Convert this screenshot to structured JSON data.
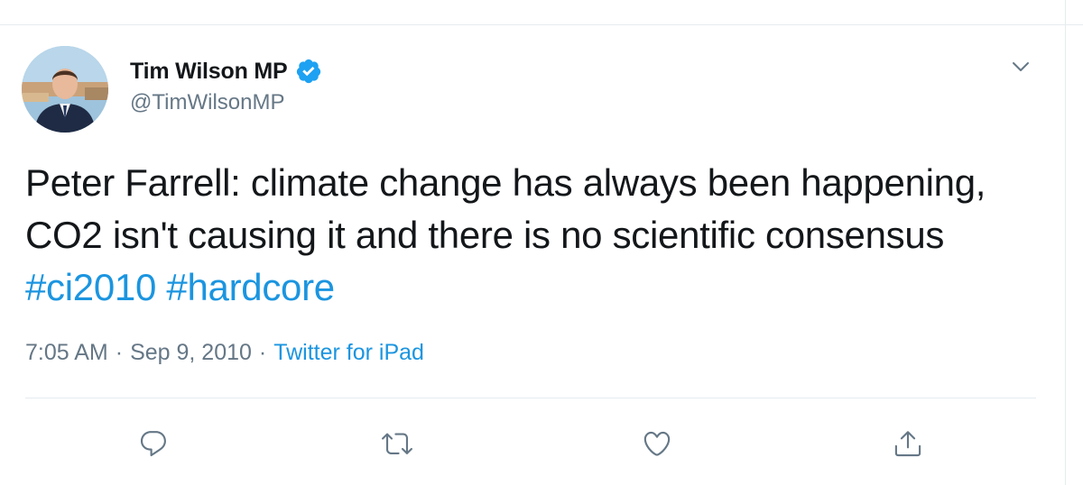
{
  "tweet": {
    "author": {
      "name": "Tim Wilson MP",
      "handle": "@TimWilsonMP",
      "verified": true
    },
    "text_plain": "Peter Farrell: climate change has always been happening, CO2 isn't causing it and there is no scientific consensus",
    "hashtags": [
      "#ci2010",
      "#hardcore"
    ],
    "meta": {
      "time": "7:05 AM",
      "separator": "·",
      "date": "Sep 9, 2010",
      "source": "Twitter for iPad"
    }
  },
  "icons": {
    "verified": "verified-badge-icon",
    "caret": "chevron-down-icon",
    "reply": "reply-icon",
    "retweet": "retweet-icon",
    "like": "like-heart-icon",
    "share": "share-icon"
  },
  "colors": {
    "text": "#14171a",
    "secondary": "#657786",
    "link": "#1b95e0",
    "verified": "#1da1f2",
    "divider": "#e6ecf0"
  }
}
